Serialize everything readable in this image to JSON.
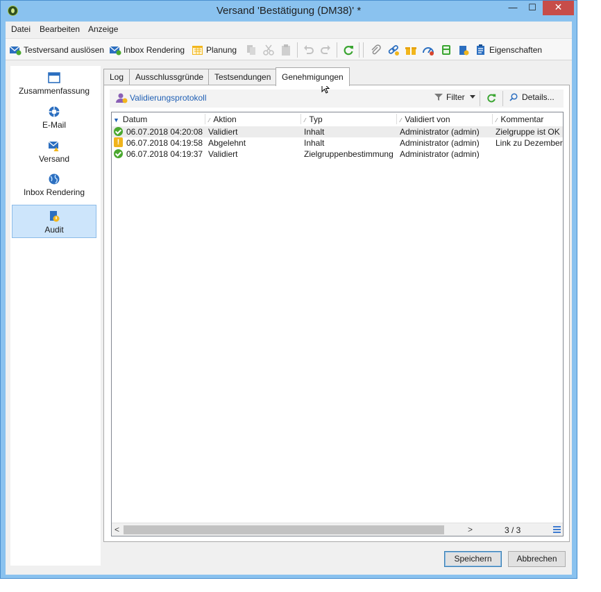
{
  "window": {
    "title": "Versand 'Bestätigung (DM38)' *",
    "minimize_glyph": "—",
    "maximize_glyph": "☐",
    "close_glyph": "✕"
  },
  "menu": [
    "Datei",
    "Bearbeiten",
    "Anzeige"
  ],
  "toolbar": {
    "test_send": "Testversand auslösen",
    "inbox_rendering": "Inbox Rendering",
    "planning": "Planung",
    "properties": "Eigenschaften"
  },
  "sidebar": {
    "items": [
      {
        "label": "Zusammenfassung",
        "icon": "summary-icon"
      },
      {
        "label": "E-Mail",
        "icon": "email-icon"
      },
      {
        "label": "Versand",
        "icon": "delivery-icon"
      },
      {
        "label": "Inbox Rendering",
        "icon": "globe-icon"
      },
      {
        "label": "Audit",
        "icon": "audit-icon",
        "active": true
      }
    ]
  },
  "tabs": [
    "Log",
    "Ausschlussgründe",
    "Testsendungen",
    "Genehmigungen"
  ],
  "active_tab": "Genehmigungen",
  "panel": {
    "validation_log": "Validierungsprotokoll",
    "filter": "Filter",
    "details": "Details..."
  },
  "table": {
    "columns": [
      "Datum",
      "Aktion",
      "Typ",
      "Validiert von",
      "Kommentar"
    ],
    "rows": [
      {
        "status": "ok",
        "date": "06.07.2018 04:20:08",
        "action": "Validiert",
        "type": "Inhalt",
        "validated_by": "Administrator (admin)",
        "comment": "Zielgruppe ist OK"
      },
      {
        "status": "warning",
        "date": "06.07.2018 04:19:58",
        "action": "Abgelehnt",
        "type": "Inhalt",
        "validated_by": "Administrator (admin)",
        "comment": "Link zu Dezember-"
      },
      {
        "status": "ok",
        "date": "06.07.2018 04:19:37",
        "action": "Validiert",
        "type": "Zielgruppenbestimmung",
        "validated_by": "Administrator (admin)",
        "comment": ""
      }
    ],
    "count": "3 / 3",
    "warn_glyph": "!",
    "scroll_left_glyph": "<",
    "scroll_right_glyph": ">"
  },
  "buttons": {
    "save": "Speichern",
    "cancel": "Abbrechen"
  },
  "colors": {
    "titlebar": "#8ac2ef",
    "accent": "#1f5fb4",
    "close": "#c74d49",
    "ok": "#4aa82f",
    "warning": "#f0b41c"
  }
}
